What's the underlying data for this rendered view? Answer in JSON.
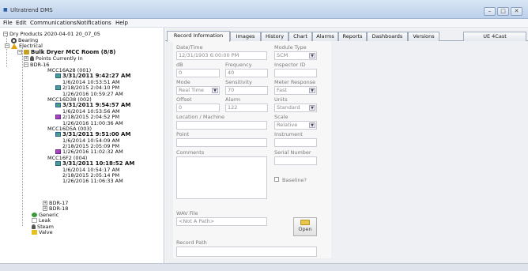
{
  "window": {
    "title": "Ultratrend DMS",
    "icon": "app-icon"
  },
  "menu": [
    "File",
    "Edit",
    "Communications",
    "Notifications",
    "Help"
  ],
  "tree": {
    "root": "Dry Products 2020-04-01 20_07_05",
    "bearing": "Bearing",
    "electrical": "Electrical",
    "machine": "Bulk Dryer MCC Room (8/8)",
    "points_currently_in": "Points Currently In",
    "bdr16": "BDR-16",
    "groups": [
      {
        "name": "MCC16A28 (001)",
        "records": [
          "3/31/2011 9:42:27 AM",
          "1/6/2014 10:53:51 AM",
          "2/18/2015 2:04:10 PM",
          "1/26/2016 10:59:27 AM"
        ]
      },
      {
        "name": "MCC16D38 (002)",
        "records": [
          "3/31/2011 9:54:57 AM",
          "1/6/2014 10:53:56 AM",
          "2/18/2015 2:04:52 PM",
          "1/26/2016 11:00:36 AM"
        ]
      },
      {
        "name": "MCC16D5A (003)",
        "records": [
          "3/31/2011 9:51:00 AM",
          "1/6/2014 10:54:09 AM",
          "2/18/2015 2:05:09 PM",
          "1/26/2016 11:02:32 AM"
        ]
      },
      {
        "name": "MCC16F2 (004)",
        "records": [
          "3/31/2011 10:18:52 AM",
          "1/6/2014 10:54:17 AM",
          "2/18/2015 2:05:14 PM",
          "1/26/2016 11:06:33 AM"
        ]
      }
    ],
    "bdr17": "BDR-17",
    "bdr18": "BDR-18",
    "generic": "Generic",
    "leak": "Leak",
    "steam": "Steam",
    "valve": "Valve"
  },
  "tabs": [
    "Record Information",
    "Images",
    "History",
    "Chart",
    "Alarms",
    "Reports",
    "Dashboards",
    "Versions"
  ],
  "active_tab": "Record Information",
  "ue_tab": "UE 4Cast",
  "form": {
    "datetime_label": "Date/Time",
    "datetime_value": "12/31/1903 6:00:00 PM",
    "module_type_label": "Module Type",
    "module_type_value": "SCM",
    "db_label": "dB",
    "db_value": "0",
    "frequency_label": "Frequency",
    "frequency_value": "40",
    "inspector_label": "Inspector ID",
    "inspector_value": "",
    "mode_label": "Mode",
    "mode_value": "Real Time",
    "sensitivity_label": "Sensitivity",
    "sensitivity_value": "70",
    "meter_label": "Meter Response",
    "meter_value": "Fast",
    "offset_label": "Offset",
    "offset_value": "0",
    "alarm_label": "Alarm",
    "alarm_value": "122",
    "units_label": "Units",
    "units_value": "Standard",
    "location_label": "Location / Machine",
    "location_value": "",
    "scale_label": "Scale",
    "scale_value": "Relative",
    "point_label": "Point",
    "point_value": "",
    "instrument_label": "Instrument",
    "instrument_value": "",
    "comments_label": "Comments",
    "serial_label": "Serial Number",
    "serial_value": "",
    "baseline_label": "Baseline?",
    "wav_label": "WAV File",
    "wav_value": "<Not A Path>",
    "open_label": "Open",
    "record_path_label": "Record Path"
  }
}
